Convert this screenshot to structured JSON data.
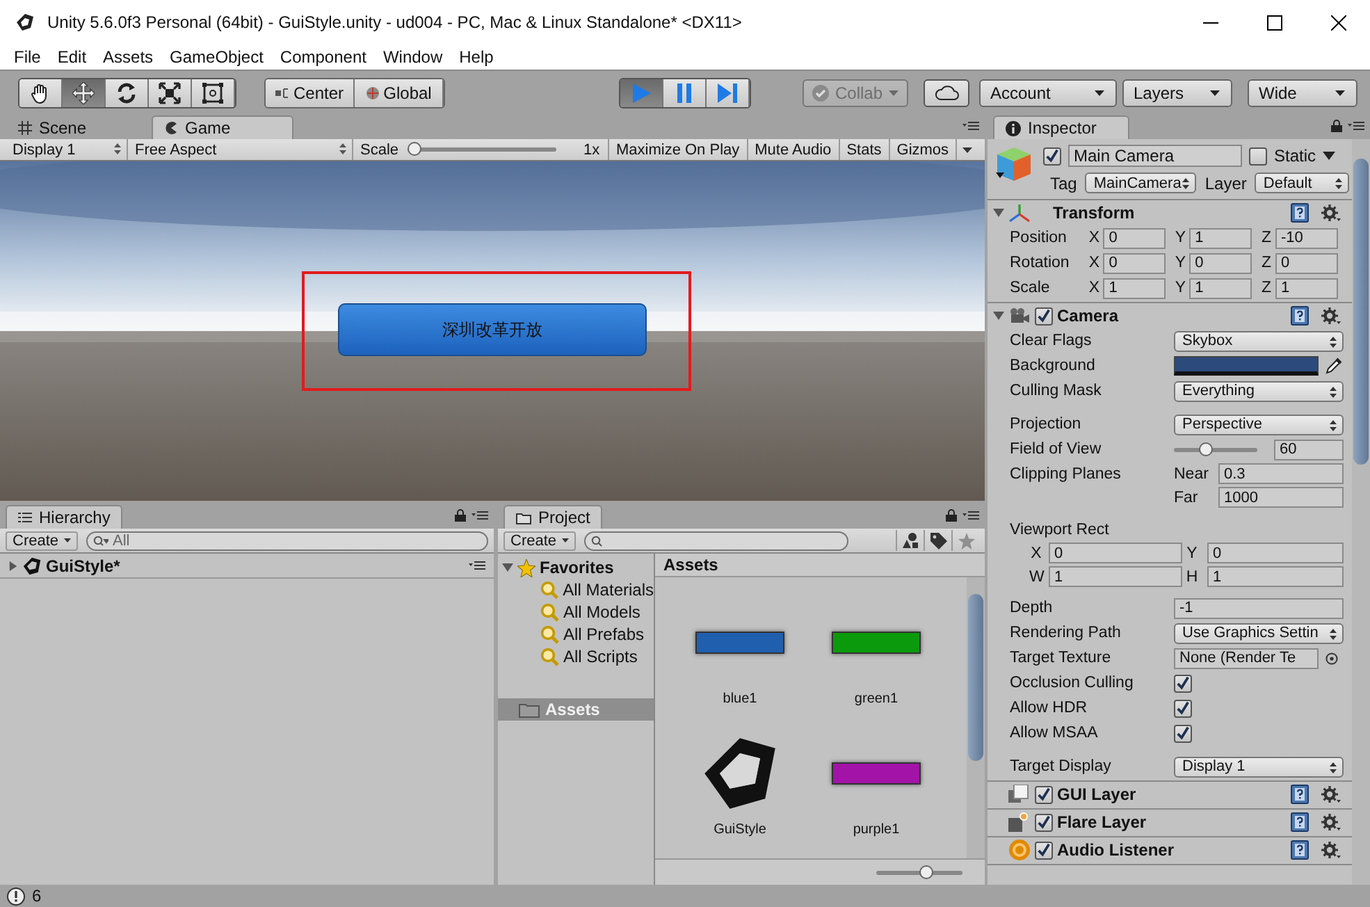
{
  "window": {
    "title": "Unity 5.6.0f3 Personal (64bit) - GuiStyle.unity - ud004 - PC, Mac & Linux Standalone* <DX11>"
  },
  "menu": [
    "File",
    "Edit",
    "Assets",
    "GameObject",
    "Component",
    "Window",
    "Help"
  ],
  "toolbar": {
    "tools": [
      {
        "kind": "hand",
        "selected": false
      },
      {
        "kind": "move",
        "selected": true
      },
      {
        "kind": "rotate",
        "selected": false
      },
      {
        "kind": "scale",
        "selected": false
      },
      {
        "kind": "rect",
        "selected": false
      }
    ],
    "pivot": [
      {
        "kind": "center",
        "label": "Center"
      },
      {
        "kind": "global",
        "label": "Global"
      }
    ],
    "playback": [
      {
        "kind": "play",
        "selected": true
      },
      {
        "kind": "pause",
        "selected": false
      },
      {
        "kind": "step",
        "selected": false
      }
    ],
    "collab": {
      "label": "Collab",
      "disabled": true
    },
    "account": "Account",
    "layers": "Layers",
    "layout": "Wide"
  },
  "scene_view": {
    "tabs": [
      {
        "kind": "scene",
        "label": "Scene",
        "selected": false
      },
      {
        "kind": "game",
        "label": "Game",
        "selected": true
      }
    ],
    "display": "Display 1",
    "aspect": "Free Aspect",
    "scale_label": "Scale",
    "scale": {
      "level": 0
    },
    "scale_value": "1x",
    "toggles": [
      "Maximize On Play",
      "Mute Audio",
      "Stats",
      "Gizmos"
    ],
    "game_button": "深圳改革开放",
    "highlight": true
  },
  "hierarchy": {
    "tab": "Hierarchy",
    "create": "Create",
    "search_placeholder": "All",
    "items": [
      {
        "label": "GuiStyle*",
        "expanded": false
      }
    ]
  },
  "project": {
    "tab": "Project",
    "create": "Create",
    "favorites": {
      "label": "Favorites",
      "expanded": true,
      "children": [
        "All Materials",
        "All Models",
        "All Prefabs",
        "All Scripts"
      ]
    },
    "folders": [
      {
        "label": "Assets",
        "selected": true
      }
    ],
    "path": "Assets",
    "assets": [
      {
        "name": "blue1",
        "kind": "material",
        "color": "#1f5fae"
      },
      {
        "name": "green1",
        "kind": "material",
        "color": "#0b9a0b"
      },
      {
        "name": "GuiStyle",
        "kind": "scene"
      },
      {
        "name": "purple1",
        "kind": "material",
        "color": "#a313a8"
      }
    ],
    "zoom": {
      "level": 0.6
    }
  },
  "inspector": {
    "tab": "Inspector",
    "object": {
      "name": "Main Camera",
      "active": true,
      "static_label": "Static",
      "static": false,
      "tag_label": "Tag",
      "tag": "MainCamera",
      "layer_label": "Layer",
      "layer": "Default"
    },
    "components": [
      {
        "kind": "transform",
        "title": "Transform",
        "expanded": true,
        "rows": [
          {
            "label": "Position",
            "axes": [
              {
                "axis": "X",
                "value": "0"
              },
              {
                "axis": "Y",
                "value": "1"
              },
              {
                "axis": "Z",
                "value": "-10"
              }
            ]
          },
          {
            "label": "Rotation",
            "axes": [
              {
                "axis": "X",
                "value": "0"
              },
              {
                "axis": "Y",
                "value": "0"
              },
              {
                "axis": "Z",
                "value": "0"
              }
            ]
          },
          {
            "label": "Scale",
            "axes": [
              {
                "axis": "X",
                "value": "1"
              },
              {
                "axis": "Y",
                "value": "1"
              },
              {
                "axis": "Z",
                "value": "1"
              }
            ]
          }
        ]
      },
      {
        "kind": "camera",
        "title": "Camera",
        "expanded": true,
        "enabled": true,
        "sections": [
          [
            {
              "kind": "dropdown",
              "label": "Clear Flags",
              "value": "Skybox"
            },
            {
              "kind": "color",
              "label": "Background",
              "color": "#2c4a7c"
            },
            {
              "kind": "dropdown",
              "label": "Culling Mask",
              "value": "Everything"
            }
          ],
          [
            {
              "kind": "dropdown",
              "label": "Projection",
              "value": "Perspective"
            },
            {
              "kind": "slider",
              "label": "Field of View",
              "level": 0.35,
              "value": "60"
            },
            {
              "kind": "pair",
              "label": "Clipping Planes",
              "fields": [
                {
                  "label": "Near",
                  "value": "0.3"
                },
                {
                  "label": "Far",
                  "value": "1000"
                }
              ]
            }
          ],
          [
            {
              "kind": "rect",
              "label": "Viewport Rect",
              "fields": [
                {
                  "label": "X",
                  "value": "0"
                },
                {
                  "label": "Y",
                  "value": "0"
                },
                {
                  "label": "W",
                  "value": "1"
                },
                {
                  "label": "H",
                  "value": "1"
                }
              ]
            }
          ],
          [
            {
              "kind": "number",
              "label": "Depth",
              "value": "-1"
            },
            {
              "kind": "dropdown",
              "label": "Rendering Path",
              "value": "Use Graphics Settin"
            },
            {
              "kind": "object",
              "label": "Target Texture",
              "value": "None (Render Te"
            },
            {
              "kind": "checkbox",
              "label": "Occlusion Culling",
              "checked": true
            },
            {
              "kind": "checkbox",
              "label": "Allow HDR",
              "checked": true
            },
            {
              "kind": "checkbox",
              "label": "Allow MSAA",
              "checked": true
            }
          ],
          [
            {
              "kind": "dropdown",
              "label": "Target Display",
              "value": "Display 1"
            }
          ]
        ]
      },
      {
        "kind": "gui_layer",
        "title": "GUI Layer",
        "enabled": true
      },
      {
        "kind": "flare_layer",
        "title": "Flare Layer",
        "enabled": true
      },
      {
        "kind": "audio_listener",
        "title": "Audio Listener",
        "enabled": true
      }
    ]
  },
  "status_bar": {
    "count": "6"
  }
}
